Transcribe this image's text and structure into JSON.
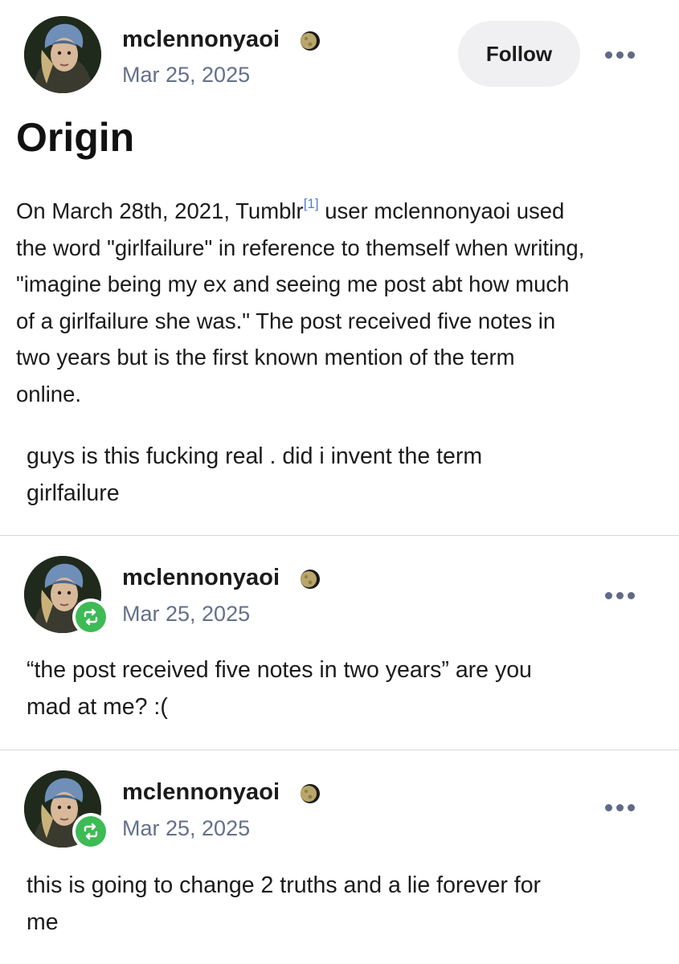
{
  "posts": [
    {
      "username": "mclennonyaoi",
      "date": "Mar 25, 2025",
      "follow_label": "Follow",
      "wiki": {
        "heading": "Origin",
        "lines": [
          "On March 28th, 2021, Tumblr",
          " user mclennonyaoi used",
          "the word \"girlfailure\" in reference to themself when writing,",
          "\"imagine being my ex and seeing me post abt how much",
          "of a girlfailure she was.\" The post received five notes in",
          "two years but is the first known mention of the term",
          "online."
        ],
        "citation": "[1]"
      },
      "body_lines": [
        "guys is this fucking real . did i invent the term",
        "girlfailure"
      ]
    },
    {
      "username": "mclennonyaoi",
      "date": "Mar 25, 2025",
      "body_lines": [
        "“the post received five notes in two years” are you",
        "mad at me? :("
      ]
    },
    {
      "username": "mclennonyaoi",
      "date": "Mar 25, 2025",
      "body_lines": [
        "this is going to change 2 truths and a lie forever for",
        "me"
      ]
    }
  ],
  "colors": {
    "reblog_green": "#3dbb55",
    "date_gray": "#64708a",
    "citation_blue": "#4f7fd0",
    "follow_bg": "#f0f0f2"
  },
  "icons": {
    "more": "more-options-icon",
    "reblog": "reblog-icon",
    "badge": "moon-badge-icon"
  }
}
